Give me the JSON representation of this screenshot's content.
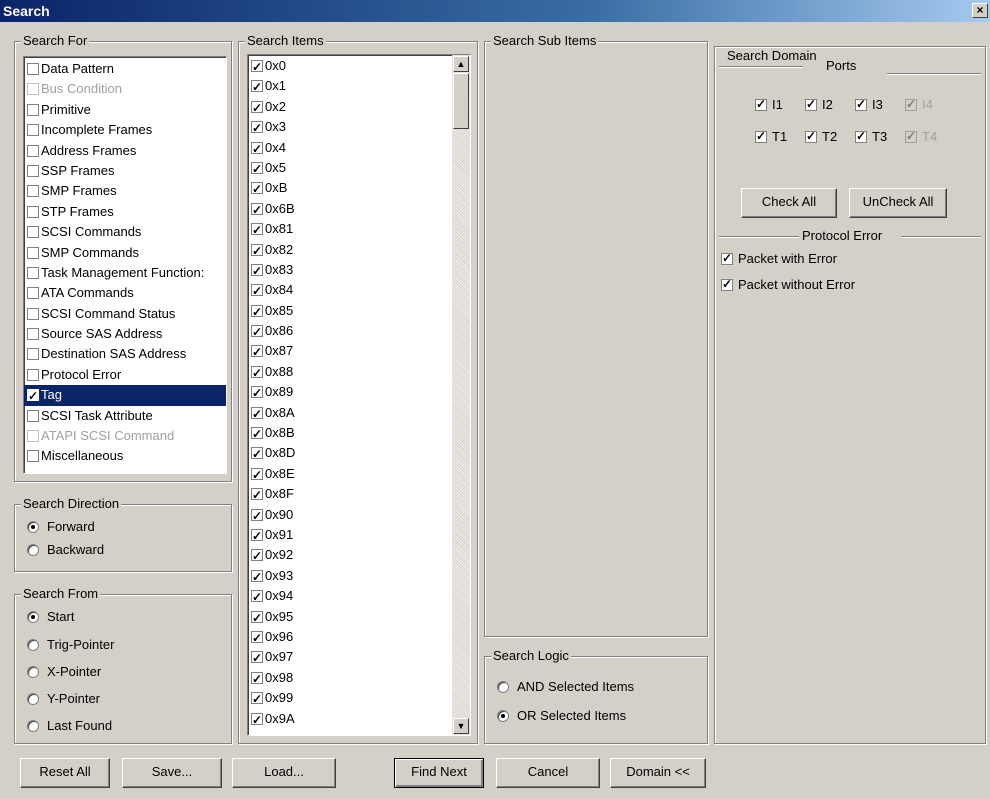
{
  "window": {
    "title": "Search",
    "close_glyph": "×"
  },
  "search_for": {
    "legend": "Search For",
    "items": [
      {
        "label": "Data Pattern",
        "checked": false,
        "disabled": false,
        "selected": false
      },
      {
        "label": "Bus Condition",
        "checked": false,
        "disabled": true,
        "selected": false
      },
      {
        "label": "Primitive",
        "checked": false,
        "disabled": false,
        "selected": false
      },
      {
        "label": "Incomplete Frames",
        "checked": false,
        "disabled": false,
        "selected": false
      },
      {
        "label": "Address Frames",
        "checked": false,
        "disabled": false,
        "selected": false
      },
      {
        "label": "SSP Frames",
        "checked": false,
        "disabled": false,
        "selected": false
      },
      {
        "label": "SMP Frames",
        "checked": false,
        "disabled": false,
        "selected": false
      },
      {
        "label": "STP Frames",
        "checked": false,
        "disabled": false,
        "selected": false
      },
      {
        "label": "SCSI Commands",
        "checked": false,
        "disabled": false,
        "selected": false
      },
      {
        "label": "SMP Commands",
        "checked": false,
        "disabled": false,
        "selected": false
      },
      {
        "label": "Task Management Function:",
        "checked": false,
        "disabled": false,
        "selected": false
      },
      {
        "label": "ATA Commands",
        "checked": false,
        "disabled": false,
        "selected": false
      },
      {
        "label": "SCSI Command Status",
        "checked": false,
        "disabled": false,
        "selected": false
      },
      {
        "label": "Source SAS Address",
        "checked": false,
        "disabled": false,
        "selected": false
      },
      {
        "label": "Destination SAS Address",
        "checked": false,
        "disabled": false,
        "selected": false
      },
      {
        "label": "Protocol Error",
        "checked": false,
        "disabled": false,
        "selected": false
      },
      {
        "label": "Tag",
        "checked": true,
        "disabled": false,
        "selected": true
      },
      {
        "label": "SCSI Task Attribute",
        "checked": false,
        "disabled": false,
        "selected": false
      },
      {
        "label": "ATAPI SCSI Command",
        "checked": false,
        "disabled": true,
        "selected": false
      },
      {
        "label": "Miscellaneous",
        "checked": false,
        "disabled": false,
        "selected": false
      }
    ]
  },
  "search_direction": {
    "legend": "Search Direction",
    "options": [
      {
        "label": "Forward",
        "selected": true
      },
      {
        "label": "Backward",
        "selected": false
      }
    ]
  },
  "search_from": {
    "legend": "Search From",
    "options": [
      {
        "label": "Start",
        "selected": true
      },
      {
        "label": "Trig-Pointer",
        "selected": false
      },
      {
        "label": "X-Pointer",
        "selected": false
      },
      {
        "label": "Y-Pointer",
        "selected": false
      },
      {
        "label": "Last Found",
        "selected": false
      }
    ]
  },
  "search_items": {
    "legend": "Search Items",
    "items": [
      "0x0",
      "0x1",
      "0x2",
      "0x3",
      "0x4",
      "0x5",
      "0xB",
      "0x6B",
      "0x81",
      "0x82",
      "0x83",
      "0x84",
      "0x85",
      "0x86",
      "0x87",
      "0x88",
      "0x89",
      "0x8A",
      "0x8B",
      "0x8D",
      "0x8E",
      "0x8F",
      "0x90",
      "0x91",
      "0x92",
      "0x93",
      "0x94",
      "0x95",
      "0x96",
      "0x97",
      "0x98",
      "0x99",
      "0x9A"
    ],
    "all_checked": true,
    "scroll_up_glyph": "▲",
    "scroll_down_glyph": "▼"
  },
  "search_sub_items": {
    "legend": "Search Sub Items"
  },
  "search_logic": {
    "legend": "Search Logic",
    "options": [
      {
        "label": "AND Selected Items",
        "selected": false
      },
      {
        "label": "OR Selected Items",
        "selected": true
      }
    ]
  },
  "search_domain": {
    "legend": "Search Domain",
    "ports_label": "Ports",
    "ports_row1": [
      {
        "label": "I1",
        "checked": true,
        "disabled": false
      },
      {
        "label": "I2",
        "checked": true,
        "disabled": false
      },
      {
        "label": "I3",
        "checked": true,
        "disabled": false
      },
      {
        "label": "I4",
        "checked": true,
        "disabled": true
      }
    ],
    "ports_row2": [
      {
        "label": "T1",
        "checked": true,
        "disabled": false
      },
      {
        "label": "T2",
        "checked": true,
        "disabled": false
      },
      {
        "label": "T3",
        "checked": true,
        "disabled": false
      },
      {
        "label": "T4",
        "checked": true,
        "disabled": true
      }
    ],
    "check_all_label": "Check All",
    "uncheck_all_label": "UnCheck All",
    "protocol_error_label": "Protocol Error",
    "packet_with_error_label": "Packet with Error",
    "packet_with_error_checked": true,
    "packet_without_error_label": "Packet without Error",
    "packet_without_error_checked": true
  },
  "buttons": {
    "reset_all": "Reset All",
    "save": "Save...",
    "load": "Load...",
    "find_next": "Find Next",
    "cancel": "Cancel",
    "domain": "Domain <<"
  }
}
